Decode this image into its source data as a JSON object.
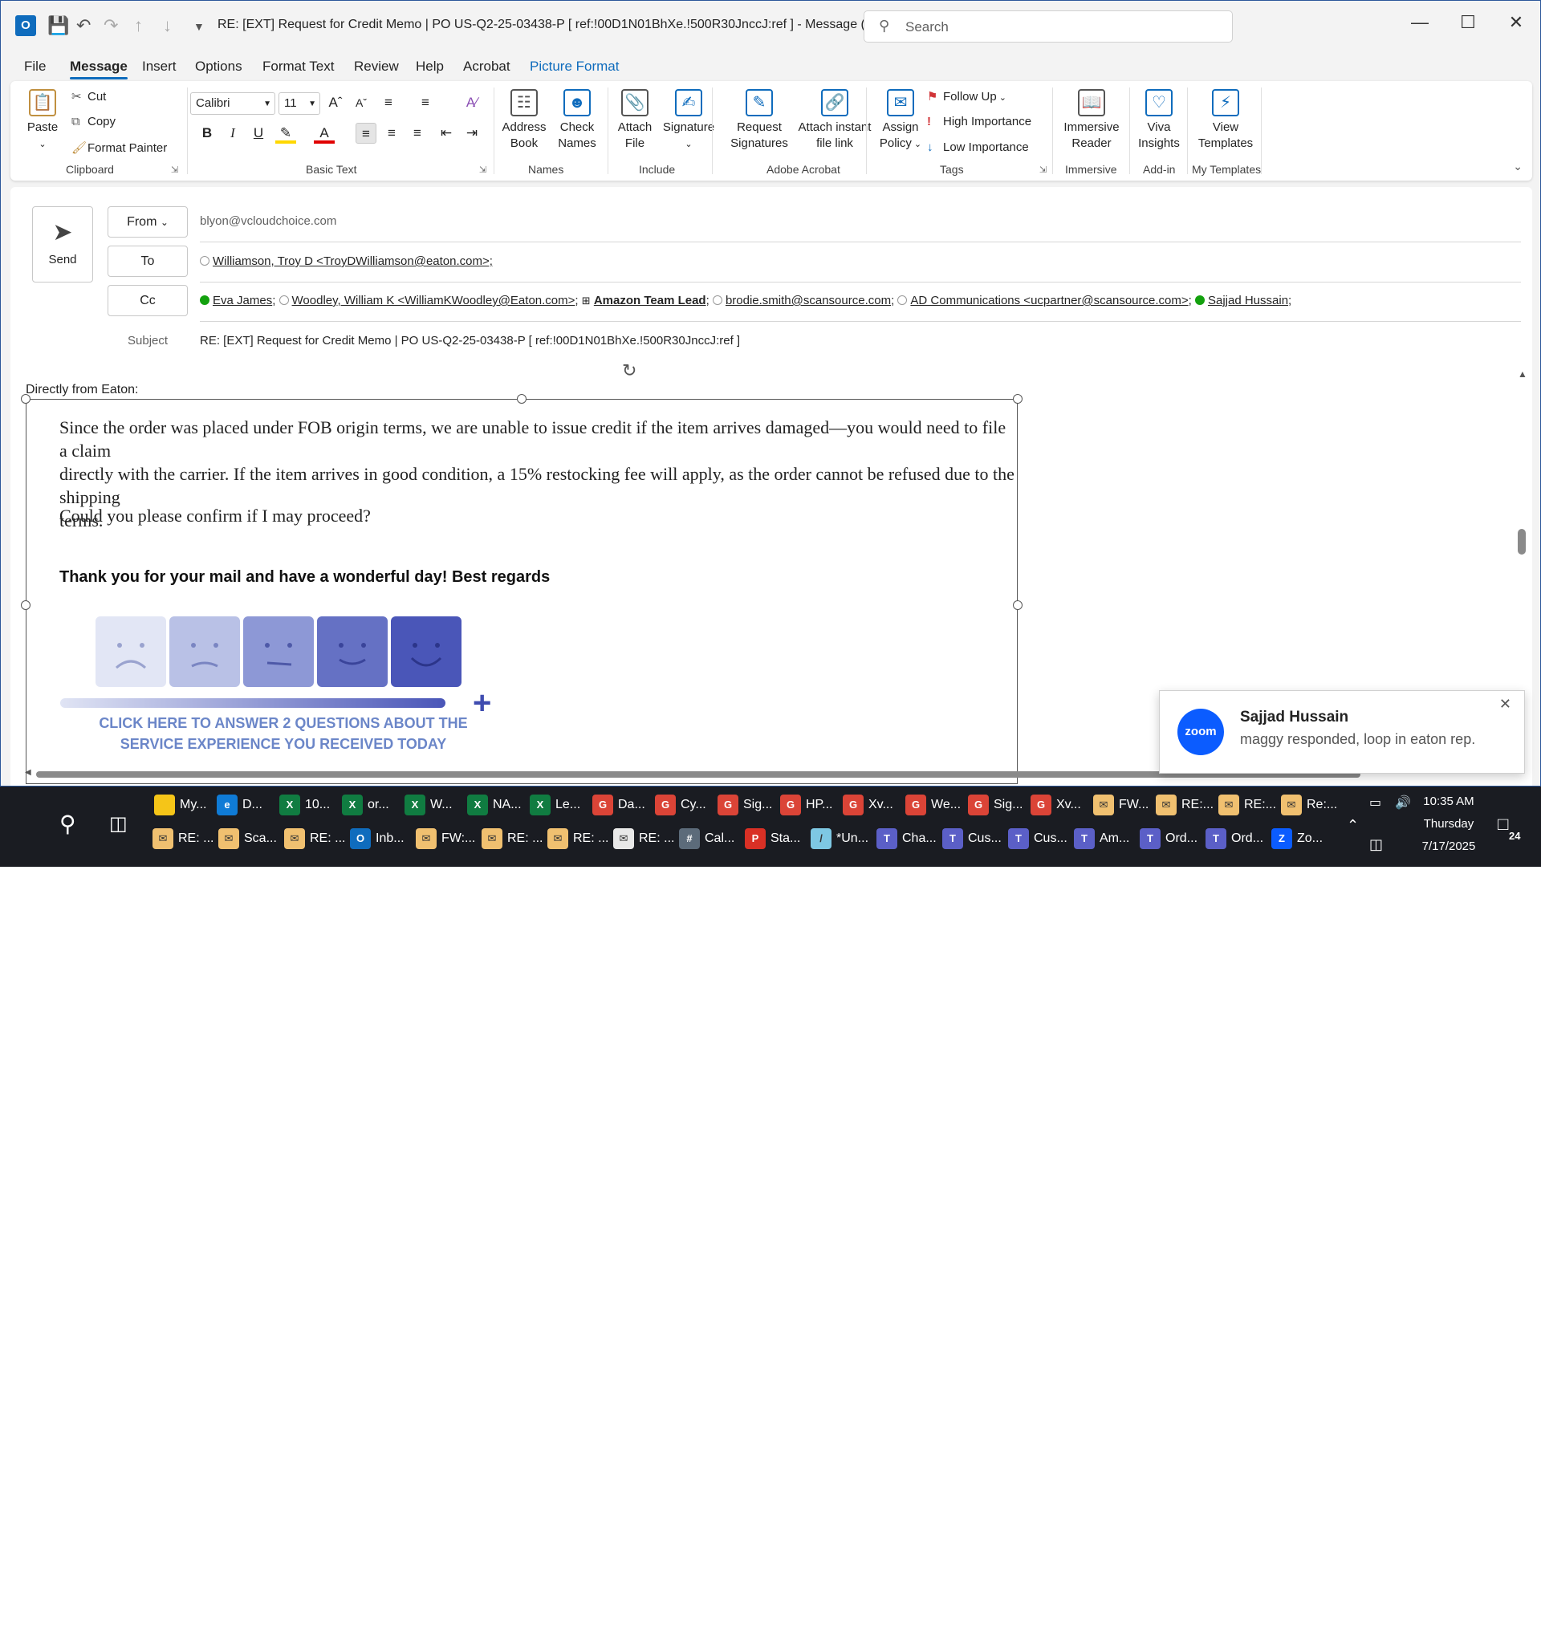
{
  "titlebar": {
    "title": "RE: [EXT] Request for Credit Memo | PO US-Q2-25-03438-P    [ ref:!00D1N01BhXe.!500R30JnccJ:ref ]  -  Message (HT...",
    "search_placeholder": "Search"
  },
  "tabs": [
    {
      "label": "File"
    },
    {
      "label": "Message"
    },
    {
      "label": "Insert"
    },
    {
      "label": "Options"
    },
    {
      "label": "Format Text"
    },
    {
      "label": "Review"
    },
    {
      "label": "Help"
    },
    {
      "label": "Acrobat"
    },
    {
      "label": "Picture Format"
    }
  ],
  "ribbon": {
    "clipboard": {
      "paste": "Paste",
      "cut": "Cut",
      "copy": "Copy",
      "format_painter": "Format Painter",
      "label": "Clipboard"
    },
    "basic_text": {
      "font": "Calibri",
      "size": "11",
      "label": "Basic Text"
    },
    "names": {
      "address_book_1": "Address",
      "address_book_2": "Book",
      "check_names_1": "Check",
      "check_names_2": "Names",
      "label": "Names"
    },
    "include": {
      "attach_1": "Attach",
      "attach_2": "File",
      "signature": "Signature",
      "label": "Include"
    },
    "adobe": {
      "req_1": "Request",
      "req_2": "Signatures",
      "attach_instant_1": "Attach instant",
      "attach_instant_2": "file link",
      "label": "Adobe Acrobat"
    },
    "tags": {
      "assign_1": "Assign",
      "assign_2": "Policy",
      "follow_up": "Follow Up",
      "high": "High Importance",
      "low": "Low Importance",
      "label": "Tags"
    },
    "immersive": {
      "btn_1": "Immersive",
      "btn_2": "Reader",
      "label": "Immersive"
    },
    "addin": {
      "btn_1": "Viva",
      "btn_2": "Insights",
      "label": "Add-in"
    },
    "templates": {
      "btn_1": "View",
      "btn_2": "Templates",
      "label": "My Templates"
    }
  },
  "compose": {
    "send": "Send",
    "from_label": "From",
    "from_value": "blyon@vcloudchoice.com",
    "to_label": "To",
    "to_value": "Williamson, Troy D <TroyDWilliamson@eaton.com>;",
    "cc_label": "Cc",
    "cc": [
      {
        "text": "Eva James",
        "status": "green"
      },
      {
        "text": "Woodley, William K <WilliamKWoodley@Eaton.com>",
        "status": "empty"
      },
      {
        "text": "Amazon Team Lead",
        "status": "group"
      },
      {
        "text": "brodie.smith@scansource.com",
        "status": "empty"
      },
      {
        "text": "AD Communications <ucpartner@scansource.com>",
        "status": "empty"
      },
      {
        "text": "Sajjad Hussain",
        "status": "green"
      }
    ],
    "subject_label": "Subject",
    "subject_value": "RE: [EXT] Request for Credit Memo | PO US-Q2-25-03438-P    [ ref:!00D1N01BhXe.!500R30JnccJ:ref ]"
  },
  "body": {
    "pre": "Directly from Eaton:",
    "para1_l1": "Since the order was placed under FOB origin terms, we are unable to issue credit if the item arrives damaged—you would need to file a claim",
    "para1_l2": "directly with the carrier. If the item arrives in good condition, a 15% restocking fee will apply, as the order cannot be refused due to the shipping",
    "para1_l3": "terms.",
    "para2": "Could you please confirm if I may proceed?",
    "thanks": "Thank you for your mail and have a wonderful day! Best regards",
    "survey_l1": "CLICK HERE TO ANSWER 2 QUESTIONS ABOUT THE",
    "survey_l2": "SERVICE EXPERIENCE YOU RECEIVED TODAY"
  },
  "toast": {
    "name": "Sajjad Hussain",
    "message": "maggy responded, loop in eaton rep.",
    "logo": "zoom"
  },
  "taskbar": {
    "row1": [
      {
        "label": "My...",
        "color": "#f5c518",
        "icon": ""
      },
      {
        "label": "D...",
        "color": "#0f7bd6",
        "icon": "e"
      },
      {
        "label": "10...",
        "color": "#107c41",
        "icon": "X"
      },
      {
        "label": "or...",
        "color": "#107c41",
        "icon": "X"
      },
      {
        "label": "W...",
        "color": "#107c41",
        "icon": "X"
      },
      {
        "label": "NA...",
        "color": "#107c41",
        "icon": "X"
      },
      {
        "label": "Le...",
        "color": "#107c41",
        "icon": "X"
      },
      {
        "label": "Da...",
        "color": "#db4437",
        "icon": "G"
      },
      {
        "label": "Cy...",
        "color": "#db4437",
        "icon": "G"
      },
      {
        "label": "Sig...",
        "color": "#db4437",
        "icon": "G"
      },
      {
        "label": "HP...",
        "color": "#db4437",
        "icon": "G"
      },
      {
        "label": "Xv...",
        "color": "#db4437",
        "icon": "G"
      },
      {
        "label": "We...",
        "color": "#db4437",
        "icon": "G"
      },
      {
        "label": "Sig...",
        "color": "#db4437",
        "icon": "G"
      },
      {
        "label": "Xv...",
        "color": "#db4437",
        "icon": "G"
      },
      {
        "label": "FW...",
        "color": "#f0c070",
        "icon": "✉"
      },
      {
        "label": "RE:...",
        "color": "#f0c070",
        "icon": "✉"
      },
      {
        "label": "RE:...",
        "color": "#f0c070",
        "icon": "✉"
      },
      {
        "label": "Re:...",
        "color": "#f0c070",
        "icon": "✉"
      }
    ],
    "row2": [
      {
        "label": "RE: ...",
        "color": "#f0c070",
        "icon": "✉"
      },
      {
        "label": "Sca...",
        "color": "#f0c070",
        "icon": "✉"
      },
      {
        "label": "RE: ...",
        "color": "#f0c070",
        "icon": "✉"
      },
      {
        "label": "Inb...",
        "color": "#0f6cbd",
        "icon": "O"
      },
      {
        "label": "FW:...",
        "color": "#f0c070",
        "icon": "✉"
      },
      {
        "label": "RE: ...",
        "color": "#f0c070",
        "icon": "✉"
      },
      {
        "label": "RE: ...",
        "color": "#f0c070",
        "icon": "✉"
      },
      {
        "label": "RE: ...",
        "color": "#e8e8e8",
        "icon": "✉"
      },
      {
        "label": "Cal...",
        "color": "#5c6b7a",
        "icon": "#"
      },
      {
        "label": "Sta...",
        "color": "#d93025",
        "icon": "P"
      },
      {
        "label": "*Un...",
        "color": "#7ec8e3",
        "icon": "/"
      },
      {
        "label": "Cha...",
        "color": "#5b5fc7",
        "icon": "T"
      },
      {
        "label": "Cus...",
        "color": "#5b5fc7",
        "icon": "T"
      },
      {
        "label": "Cus...",
        "color": "#5b5fc7",
        "icon": "T"
      },
      {
        "label": "Am...",
        "color": "#5b5fc7",
        "icon": "T"
      },
      {
        "label": "Ord...",
        "color": "#5b5fc7",
        "icon": "T"
      },
      {
        "label": "Ord...",
        "color": "#5b5fc7",
        "icon": "T"
      },
      {
        "label": "Zo...",
        "color": "#0b5cff",
        "icon": "Z"
      }
    ],
    "time": "10:35 AM",
    "day": "Thursday",
    "date": "7/17/2025",
    "notif_count": "24"
  }
}
